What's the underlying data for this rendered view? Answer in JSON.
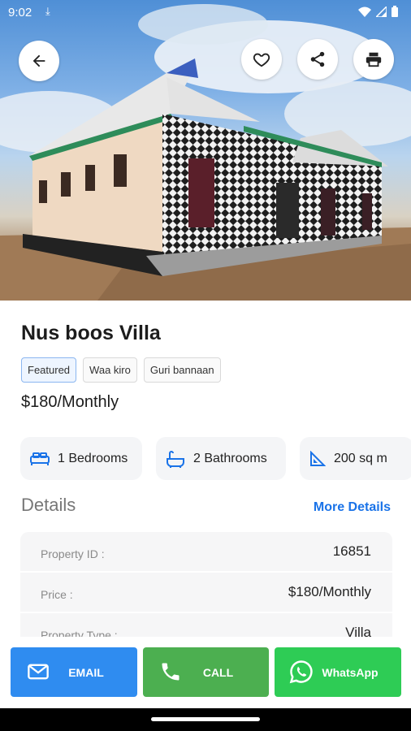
{
  "status_bar": {
    "time": "9:02",
    "download_icon": "download-icon",
    "icons": [
      "wifi-icon",
      "signal-icon",
      "battery-icon"
    ]
  },
  "hero": {
    "description_icon": "property-photo"
  },
  "top_actions": {
    "back": "arrow-left-icon",
    "favorite": "heart-icon",
    "share": "share-icon",
    "print": "print-icon"
  },
  "property": {
    "title": "Nus boos Villa",
    "tags": [
      "Featured",
      "Waa kiro",
      "Guri bannaan"
    ],
    "price": "$180/Monthly"
  },
  "features": [
    {
      "icon": "bed-icon",
      "label": "1 Bedrooms"
    },
    {
      "icon": "bathtub-icon",
      "label": "2 Bathrooms"
    },
    {
      "icon": "area-icon",
      "label": "200 sq m"
    }
  ],
  "details": {
    "heading": "Details",
    "more_link": "More Details",
    "rows": [
      {
        "key": "Property ID :",
        "value": "16851"
      },
      {
        "key": "Price :",
        "value": "$180/Monthly"
      },
      {
        "key": "Property Type :",
        "value": "Villa"
      }
    ]
  },
  "actions": {
    "email": "EMAIL",
    "call": "CALL",
    "whatsapp": "WhatsApp"
  },
  "colors": {
    "accent": "#1a73e8",
    "email": "#2f8cf0",
    "call": "#4caf50",
    "whatsapp": "#2ecc55"
  }
}
